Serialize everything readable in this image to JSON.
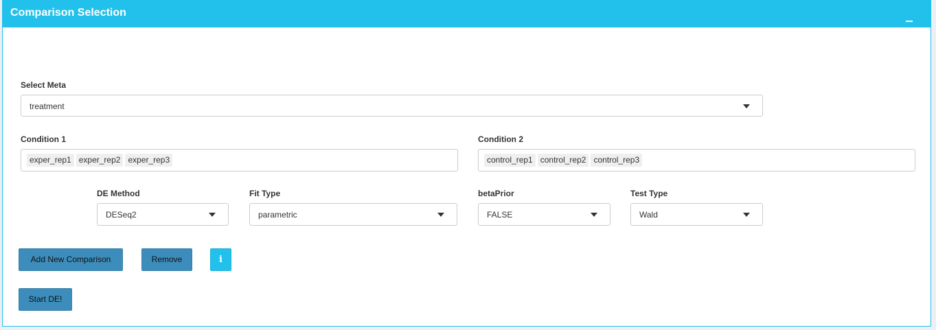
{
  "panel": {
    "title": "Comparison Selection",
    "collapse_icon": "minus-icon"
  },
  "select_meta": {
    "label": "Select Meta",
    "value": "treatment"
  },
  "condition1": {
    "label": "Condition 1",
    "chips": [
      "exper_rep1",
      "exper_rep2",
      "exper_rep3"
    ]
  },
  "condition2": {
    "label": "Condition 2",
    "chips": [
      "control_rep1",
      "control_rep2",
      "control_rep3"
    ]
  },
  "de_method": {
    "label": "DE Method",
    "value": "DESeq2"
  },
  "fit_type": {
    "label": "Fit Type",
    "value": "parametric"
  },
  "beta_prior": {
    "label": "betaPrior",
    "value": "FALSE"
  },
  "test_type": {
    "label": "Test Type",
    "value": "Wald"
  },
  "buttons": {
    "add_new": "Add New Comparison",
    "remove": "Remove",
    "info_icon": "info-icon",
    "start": "Start DE!"
  },
  "colors": {
    "header": "#22c1ec",
    "primary_button": "#3c8dbc",
    "info_button": "#22c1ec"
  }
}
